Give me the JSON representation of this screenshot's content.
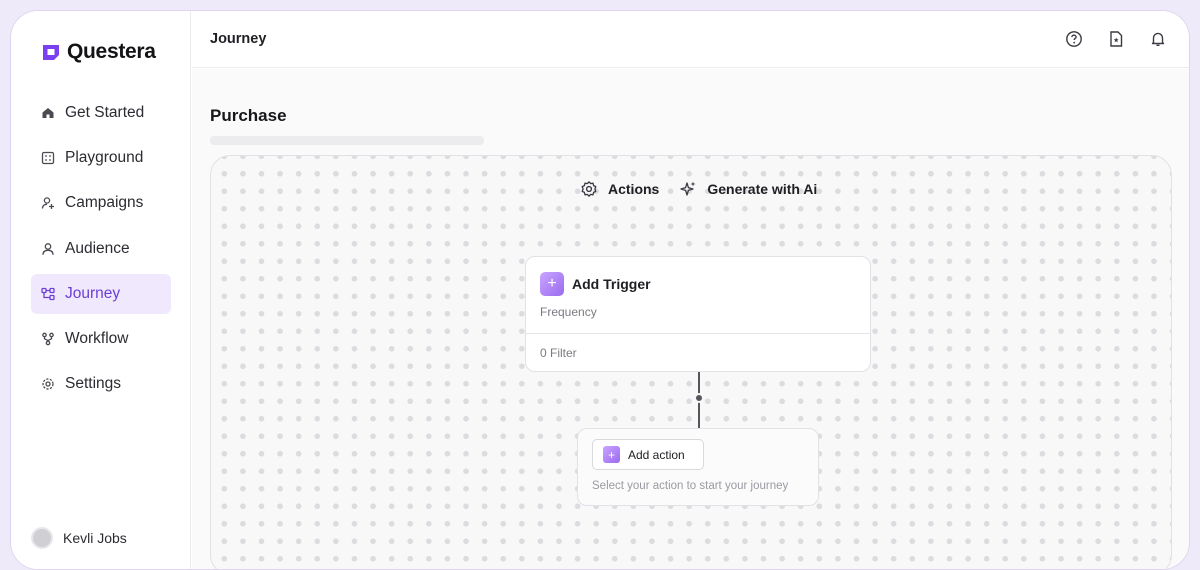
{
  "app": {
    "name": "Questera",
    "brand_color": "#7b3ff2"
  },
  "sidebar": {
    "items": [
      {
        "label": "Get Started",
        "icon": "home-icon",
        "active": false
      },
      {
        "label": "Playground",
        "icon": "grid-icon",
        "active": false
      },
      {
        "label": "Campaigns",
        "icon": "user-plus-icon",
        "active": false
      },
      {
        "label": "Audience",
        "icon": "user-icon",
        "active": false
      },
      {
        "label": "Journey",
        "icon": "journey-icon",
        "active": true
      },
      {
        "label": "Workflow",
        "icon": "workflow-icon",
        "active": false
      },
      {
        "label": "Settings",
        "icon": "gear-icon",
        "active": false
      }
    ],
    "user": {
      "name": "Kevli Jobs"
    }
  },
  "header": {
    "breadcrumb": "Journey",
    "icons": [
      "help-icon",
      "document-icon",
      "bell-icon"
    ]
  },
  "main": {
    "title": "Purchase",
    "toolbar": {
      "actions_label": "Actions",
      "generate_label": "Generate with Ai"
    },
    "trigger": {
      "title": "Add Trigger",
      "subtitle": "Frequency",
      "filter": "0 Filter"
    },
    "action": {
      "button_label": "Add action",
      "hint": "Select your action to start your journey"
    }
  }
}
